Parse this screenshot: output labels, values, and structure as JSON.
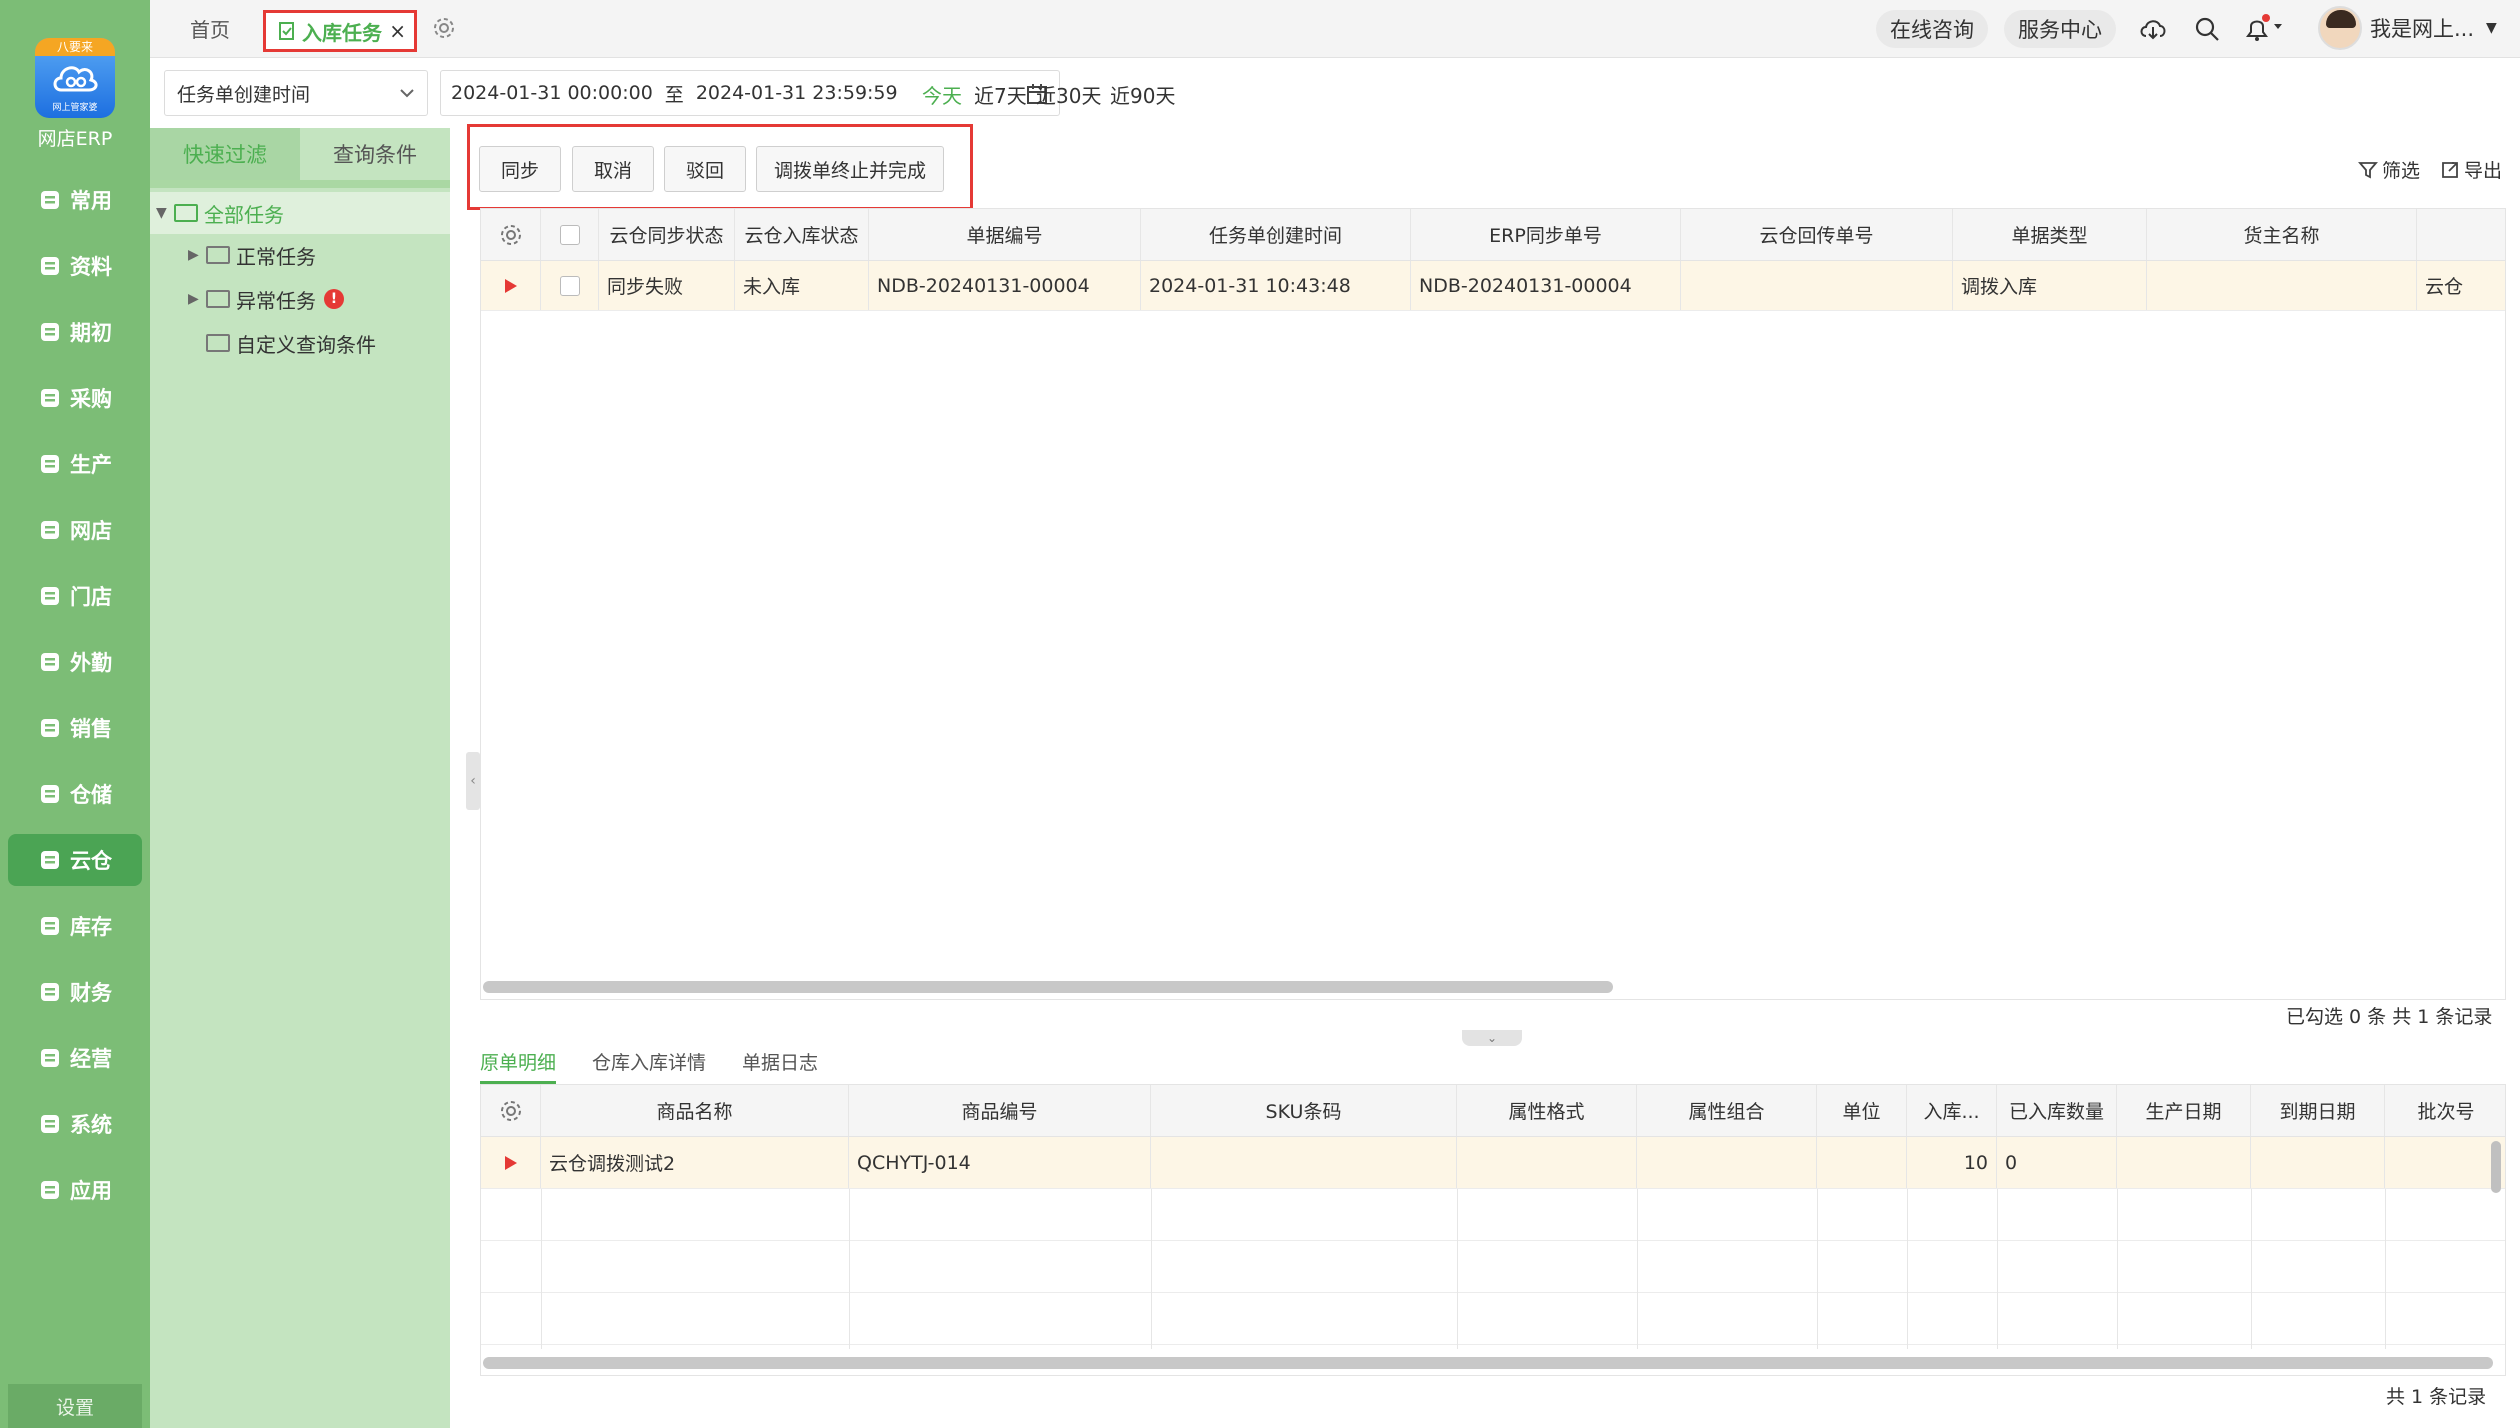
{
  "app": {
    "logo_ribbon": "八要来",
    "logo_sub": "网上管家婆",
    "brand": "网店ERP",
    "settings_label": "设置"
  },
  "nav": {
    "items": [
      {
        "label": "常用",
        "icon": "star-icon"
      },
      {
        "label": "资料",
        "icon": "document-icon"
      },
      {
        "label": "期初",
        "icon": "target-icon"
      },
      {
        "label": "采购",
        "icon": "purchase-icon"
      },
      {
        "label": "生产",
        "icon": "production-icon"
      },
      {
        "label": "网店",
        "icon": "shop-icon"
      },
      {
        "label": "门店",
        "icon": "pie-icon"
      },
      {
        "label": "外勤",
        "icon": "field-icon"
      },
      {
        "label": "销售",
        "icon": "sales-icon"
      },
      {
        "label": "仓储",
        "icon": "warehouse-icon"
      },
      {
        "label": "云仓",
        "icon": "cloud-warehouse-icon",
        "active": true
      },
      {
        "label": "库存",
        "icon": "inventory-icon"
      },
      {
        "label": "财务",
        "icon": "finance-icon"
      },
      {
        "label": "经营",
        "icon": "business-icon"
      },
      {
        "label": "系统",
        "icon": "system-icon"
      },
      {
        "label": "应用",
        "icon": "apps-icon"
      }
    ]
  },
  "topbar": {
    "home_tab": "首页",
    "active_tab": "入库任务",
    "close": "×",
    "online_consult": "在线咨询",
    "service_center": "服务中心",
    "user_name": "我是网上..."
  },
  "filter": {
    "date_type": "任务单创建时间",
    "date_from": "2024-01-31 00:00:00",
    "date_sep": "至",
    "date_to": "2024-01-31 23:59:59",
    "quick": [
      "今天",
      "近7天",
      "近30天",
      "近90天"
    ]
  },
  "panel": {
    "tabs": [
      "快速过滤",
      "查询条件"
    ],
    "tree": [
      {
        "label": "全部任务",
        "arrow": "▼",
        "selected": true
      },
      {
        "label": "正常任务",
        "arrow": "▶"
      },
      {
        "label": "异常任务",
        "arrow": "▶",
        "badge": "!"
      },
      {
        "label": "自定义查询条件",
        "arrow": ""
      }
    ]
  },
  "actions": {
    "buttons": [
      "同步",
      "取消",
      "驳回",
      "调拨单终止并完成"
    ],
    "filter_label": "筛选",
    "export_label": "导出"
  },
  "main_table": {
    "headers": [
      "云仓同步状态",
      "云仓入库状态",
      "单据编号",
      "任务单创建时间",
      "ERP同步单号",
      "云仓回传单号",
      "单据类型",
      "货主名称"
    ],
    "rows": [
      {
        "sync_status": "同步失败",
        "inbound_status": "未入库",
        "doc_no": "NDB-20240131-00004",
        "created": "2024-01-31 10:43:48",
        "erp_no": "NDB-20240131-00004",
        "callback_no": "",
        "doc_type": "调拨入库",
        "owner": "",
        "extra": "云仓"
      }
    ],
    "status": "已勾选 0 条  共 1 条记录"
  },
  "bottom": {
    "tabs": [
      "原单明细",
      "仓库入库详情",
      "单据日志"
    ],
    "headers": [
      "商品名称",
      "商品编号",
      "SKU条码",
      "属性格式",
      "属性组合",
      "单位",
      "入库...",
      "已入库数量",
      "生产日期",
      "到期日期",
      "批次号"
    ],
    "rows": [
      {
        "name": "云仓调拨测试2",
        "code": "QCHYTJ-014",
        "sku": "",
        "attr_fmt": "",
        "attr_combo": "",
        "unit": "",
        "qty": "10",
        "received": "0",
        "mfg": "",
        "exp": "",
        "batch": ""
      }
    ],
    "status": "共 1 条记录"
  },
  "colors": {
    "nav_bg": "#7cbd76",
    "nav_active": "#4ba454",
    "accent_green": "#4caf50",
    "highlight_red": "#e53935",
    "row_highlight": "#fdf6e6"
  }
}
